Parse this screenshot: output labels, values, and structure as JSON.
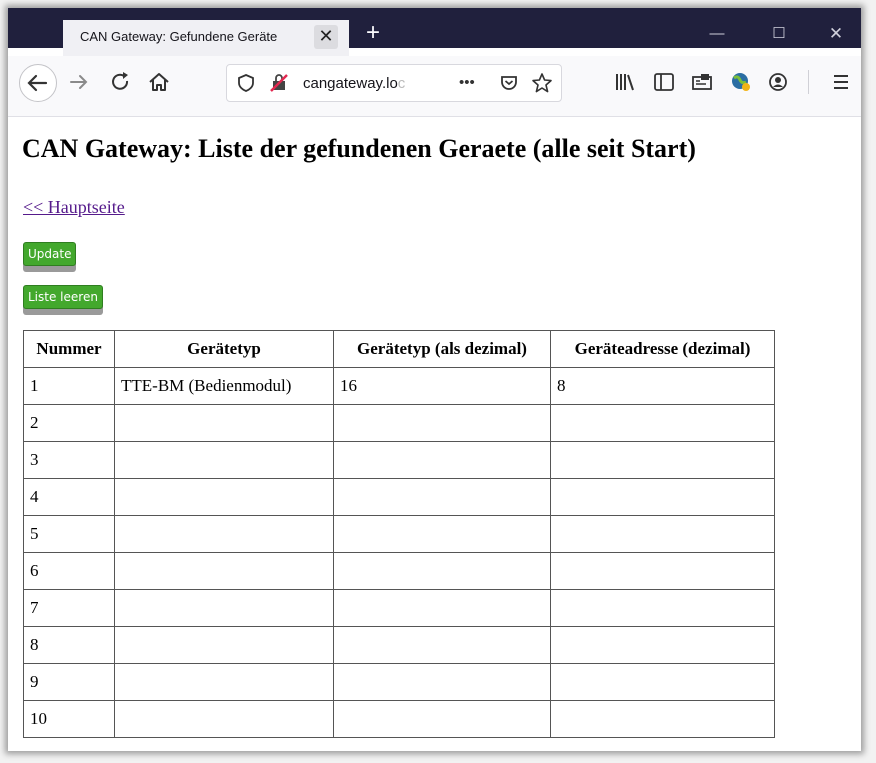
{
  "browser": {
    "tab_title": "CAN Gateway: Gefundene Geräte",
    "tab_close": "✕",
    "new_tab": "+",
    "url_text": "cangateway.lo",
    "url_fade": "c",
    "page_actions": "•••"
  },
  "page": {
    "heading": "CAN Gateway: Liste der gefundenen Geraete (alle seit Start)",
    "home_link": "<< Hauptseite",
    "update_button": "Update",
    "clear_button": "Liste leeren"
  },
  "table": {
    "headers": [
      "Nummer",
      "Gerätetyp",
      "Gerätetyp (als dezimal)",
      "Geräteadresse (dezimal)"
    ],
    "rows": [
      [
        "1",
        "TTE-BM (Bedienmodul)",
        "16",
        "8"
      ],
      [
        "2",
        "",
        "",
        ""
      ],
      [
        "3",
        "",
        "",
        ""
      ],
      [
        "4",
        "",
        "",
        ""
      ],
      [
        "5",
        "",
        "",
        ""
      ],
      [
        "6",
        "",
        "",
        ""
      ],
      [
        "7",
        "",
        "",
        ""
      ],
      [
        "8",
        "",
        "",
        ""
      ],
      [
        "9",
        "",
        "",
        ""
      ],
      [
        "10",
        "",
        "",
        ""
      ]
    ]
  },
  "colors": {
    "tabbar_bg": "#20203d",
    "button_green": "#43a82d",
    "link_visited": "#551a8b"
  }
}
